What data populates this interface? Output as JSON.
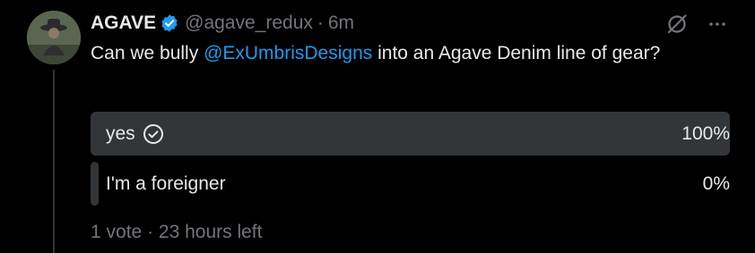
{
  "tweet": {
    "display_name": "AGAVE",
    "handle": "@agave_redux",
    "separator": "·",
    "timestamp": "6m",
    "text_before": "Can we bully ",
    "mention": "@ExUmbrisDesigns",
    "text_after": " into an Agave Denim line of gear?",
    "icons": {
      "avatar": "avatar-photo",
      "verified": "verified-badge-icon",
      "grok": "grok-icon",
      "more": "more-icon"
    },
    "colors": {
      "accent": "#1d9bf0",
      "muted_text": "#71767b",
      "poll_bar": "#333639"
    }
  },
  "poll": {
    "options": [
      {
        "label": "yes",
        "percent_text": "100%",
        "share": 1.0,
        "selected": true
      },
      {
        "label": "I'm a foreigner",
        "percent_text": "0%",
        "share": 0.0,
        "selected": false
      }
    ],
    "votes": "1 vote",
    "separator": "·",
    "time_left": "23 hours left"
  }
}
